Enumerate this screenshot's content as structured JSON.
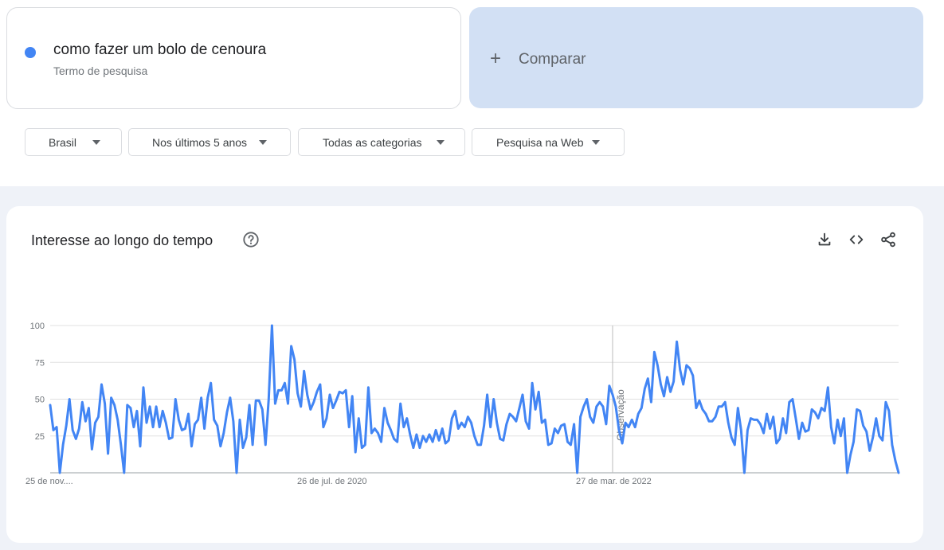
{
  "search_term": {
    "title": "como fazer um bolo de cenoura",
    "subtitle": "Termo de pesquisa",
    "color": "#4285f4"
  },
  "compare": {
    "label": "Comparar",
    "icon": "plus-icon"
  },
  "filters": [
    {
      "label": "Brasil"
    },
    {
      "label": "Nos últimos 5 anos"
    },
    {
      "label": "Todas as categorias"
    },
    {
      "label": "Pesquisa na Web"
    }
  ],
  "chart_panel": {
    "title": "Interesse ao longo do tempo",
    "icons": [
      "help-icon",
      "download-icon",
      "embed-code-icon",
      "share-icon"
    ]
  },
  "chart_data": {
    "type": "line",
    "y_ticks": [
      "25",
      "50",
      "75",
      "100"
    ],
    "ylim": [
      0,
      100
    ],
    "x_tick_labels": [
      "25 de nov....",
      "26 de jul. de 2020",
      "27 de mar. de 2022"
    ],
    "annotation": {
      "label": "Observação",
      "x_index": 175
    },
    "series_color": "#4285f4",
    "grid": true,
    "series": [
      {
        "values": [
          46,
          29,
          31,
          0,
          19,
          32,
          50,
          29,
          23,
          30,
          48,
          35,
          44,
          16,
          34,
          38,
          60,
          47,
          13,
          51,
          46,
          36,
          19,
          0,
          46,
          44,
          31,
          42,
          18,
          58,
          34,
          45,
          31,
          45,
          31,
          42,
          34,
          23,
          24,
          50,
          36,
          29,
          30,
          40,
          18,
          33,
          36,
          51,
          30,
          51,
          61,
          36,
          32,
          18,
          27,
          41,
          51,
          35,
          0,
          36,
          17,
          24,
          46,
          19,
          49,
          49,
          43,
          19,
          50,
          100,
          47,
          56,
          56,
          61,
          47,
          86,
          77,
          54,
          45,
          69,
          53,
          43,
          48,
          55,
          60,
          31,
          37,
          53,
          44,
          49,
          55,
          54,
          56,
          31,
          52,
          14,
          37,
          17,
          19,
          58,
          27,
          30,
          27,
          21,
          44,
          34,
          29,
          23,
          21,
          47,
          31,
          37,
          26,
          17,
          26,
          17,
          25,
          21,
          26,
          21,
          29,
          22,
          30,
          20,
          22,
          37,
          42,
          30,
          34,
          31,
          38,
          34,
          25,
          19,
          19,
          32,
          53,
          31,
          50,
          34,
          23,
          22,
          33,
          40,
          38,
          35,
          44,
          53,
          35,
          30,
          61,
          43,
          55,
          34,
          36,
          19,
          20,
          30,
          27,
          32,
          33,
          21,
          19,
          33,
          0,
          38,
          45,
          50,
          38,
          34,
          45,
          48,
          45,
          33,
          59,
          53,
          45,
          29,
          20,
          34,
          31,
          36,
          31,
          40,
          44,
          57,
          64,
          48,
          82,
          73,
          60,
          52,
          65,
          55,
          62,
          89,
          70,
          60,
          73,
          71,
          66,
          44,
          49,
          43,
          40,
          35,
          35,
          38,
          45,
          45,
          48,
          34,
          24,
          19,
          44,
          29,
          0,
          29,
          37,
          36,
          36,
          33,
          27,
          40,
          30,
          38,
          20,
          23,
          37,
          27,
          48,
          50,
          37,
          23,
          34,
          28,
          29,
          43,
          41,
          37,
          44,
          42,
          58,
          31,
          20,
          36,
          25,
          37,
          0,
          12,
          21,
          43,
          42,
          32,
          28,
          15,
          24,
          37,
          25,
          22,
          48,
          42,
          19,
          8,
          0
        ]
      }
    ]
  }
}
